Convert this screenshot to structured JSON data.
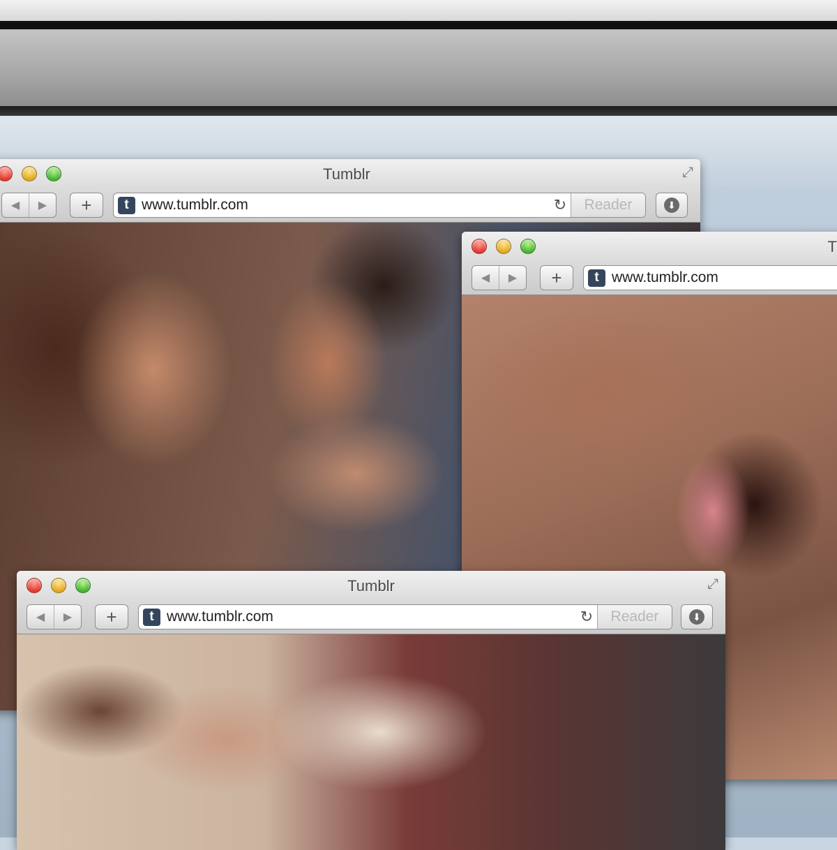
{
  "windows": [
    {
      "title": "Tumblr",
      "url": "www.tumblr.com",
      "reader_label": "Reader",
      "logo_letter": "t"
    },
    {
      "title": "T",
      "url": "www.tumblr.com",
      "logo_letter": "t"
    },
    {
      "title": "Tumblr",
      "url": "www.tumblr.com",
      "reader_label": "Reader",
      "logo_letter": "t"
    }
  ],
  "icons": {
    "back": "◀",
    "forward": "▶",
    "new_tab": "+",
    "reload": "↻",
    "download": "⬇",
    "resize": "⤢"
  }
}
